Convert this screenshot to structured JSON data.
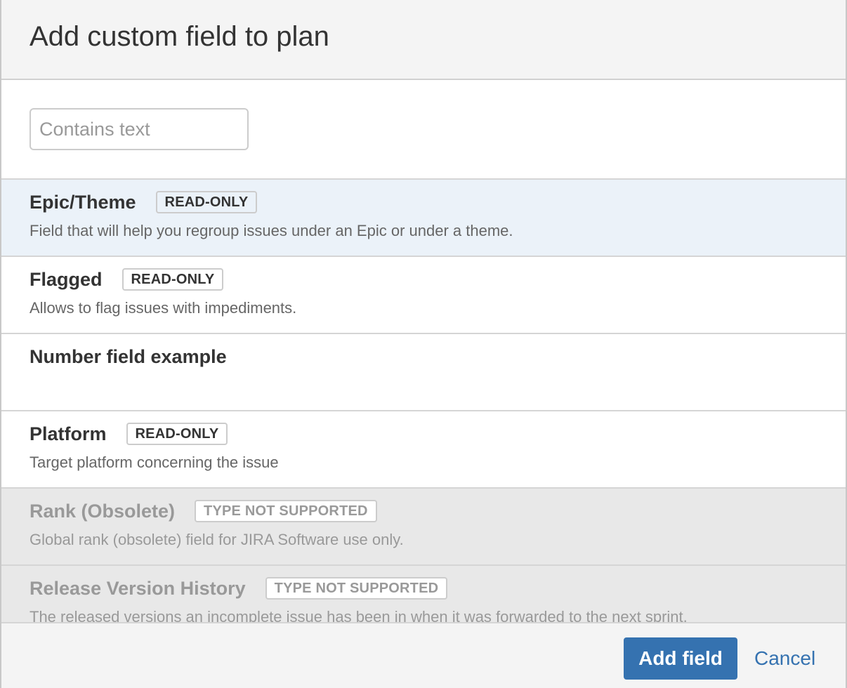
{
  "dialog": {
    "title": "Add custom field to plan"
  },
  "search": {
    "placeholder": "Contains text",
    "value": ""
  },
  "fields": [
    {
      "name": "Epic/Theme",
      "badge": "READ-ONLY",
      "description": "Field that will help you regroup issues under an Epic or under a theme.",
      "state": "selected"
    },
    {
      "name": "Flagged",
      "badge": "READ-ONLY",
      "description": "Allows to flag issues with impediments.",
      "state": "normal"
    },
    {
      "name": "Number field example",
      "badge": "",
      "description": "",
      "state": "normal"
    },
    {
      "name": "Platform",
      "badge": "READ-ONLY",
      "description": "Target platform concerning the issue",
      "state": "normal"
    },
    {
      "name": "Rank (Obsolete)",
      "badge": "TYPE NOT SUPPORTED",
      "description": "Global rank (obsolete) field for JIRA Software use only.",
      "state": "disabled"
    },
    {
      "name": "Release Version History",
      "badge": "TYPE NOT SUPPORTED",
      "description": "The released versions an incomplete issue has been in when it was forwarded to the next sprint.",
      "state": "disabled"
    }
  ],
  "footer": {
    "add_label": "Add field",
    "cancel_label": "Cancel"
  },
  "colors": {
    "primary": "#3572b0",
    "selected_row": "#ebf2f9",
    "disabled_row": "#e8e8e8",
    "header_bg": "#f4f4f4"
  }
}
